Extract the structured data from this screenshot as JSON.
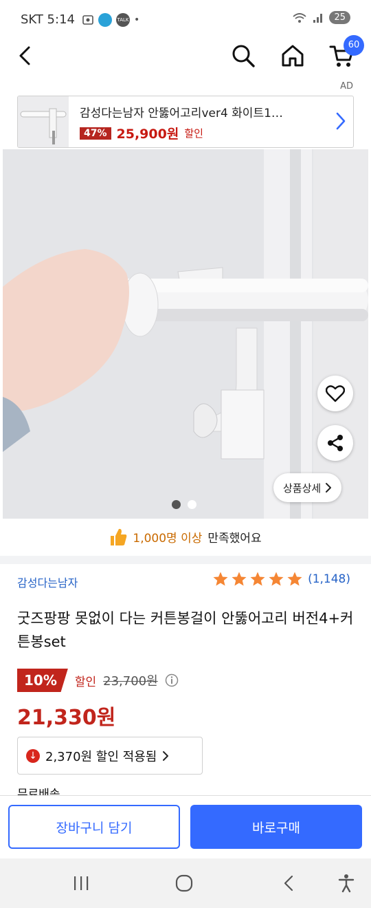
{
  "status_bar": {
    "carrier_time": "SKT 5:14",
    "battery": "25",
    "talk_label": "TALK"
  },
  "nav": {
    "cart_count": "60"
  },
  "ad": {
    "tag": "AD",
    "title": "감성다는남자 안뚫어고리ver4 화이트1…",
    "discount": "47%",
    "price": "25,900원",
    "sale_label": "할인"
  },
  "hero": {
    "detail_button": "상품상세",
    "slide_count": 2,
    "active_slide": 1
  },
  "satisfaction": {
    "highlight": "1,000명 이상",
    "suffix": "만족했어요"
  },
  "product": {
    "seller": "감성다는남자",
    "rating_count": "(1,148)",
    "stars": 5,
    "title": "굿즈팡팡 못없이 다는 커튼봉걸이 안뚫어고리 버전4+커튼봉set",
    "discount_rate": "10%",
    "discount_label": "할인",
    "original_price": "23,700원",
    "final_price": "21,330원",
    "coupon_text": "2,370원  할인 적용됨",
    "shipping": "무료배송"
  },
  "actions": {
    "cart_button": "장바구니 담기",
    "buy_button": "바로구매"
  },
  "colors": {
    "accent": "#346aff",
    "price_red": "#c1251c",
    "star": "#f58634",
    "link_blue": "#2663c7"
  }
}
